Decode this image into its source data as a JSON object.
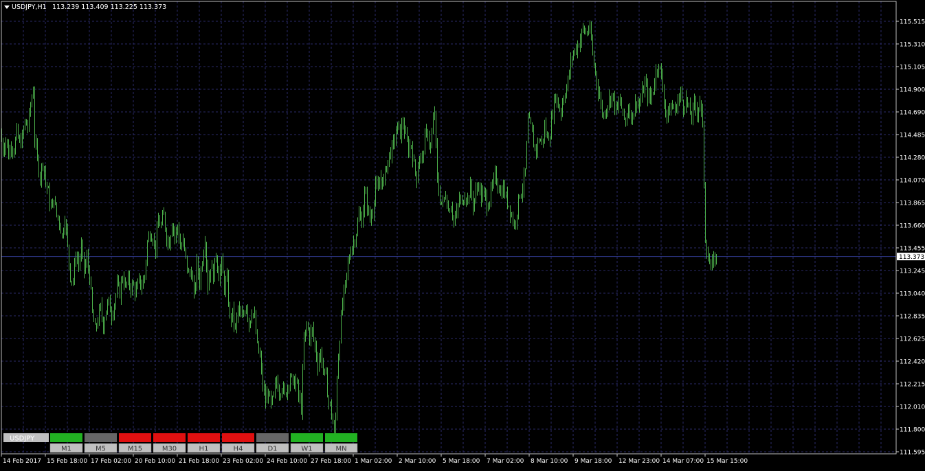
{
  "header": {
    "symbol_timeframe": "USDJPY,H1",
    "ohlc": "113.239 113.409 113.225 113.373"
  },
  "colors": {
    "background": "#000000",
    "grid": "#2a2a68",
    "axis": "#cccccc",
    "text": "#ffffff",
    "bars": "#4db24b",
    "bid_line": "#2f3a8c",
    "signal_green": "#22b222",
    "signal_red": "#e01010",
    "signal_gray": "#666666",
    "tf_label_bg": "#c0c0c0"
  },
  "indicator": {
    "symbol_label": "USDJPY",
    "timeframes": [
      "M1",
      "M5",
      "M15",
      "M30",
      "H1",
      "H4",
      "D1",
      "W1",
      "MN"
    ],
    "states": [
      "green",
      "gray",
      "red",
      "red",
      "red",
      "red",
      "gray",
      "green",
      "green"
    ]
  },
  "chart_data": {
    "type": "ohlc",
    "symbol": "USDJPY",
    "timeframe": "H1",
    "last_price": "113.373",
    "ylim": [
      111.595,
      115.605
    ],
    "y_ticks": [
      "115.515",
      "115.310",
      "115.105",
      "114.900",
      "114.690",
      "114.485",
      "114.280",
      "114.070",
      "113.865",
      "113.660",
      "113.455",
      "113.245",
      "113.040",
      "112.835",
      "112.625",
      "112.420",
      "112.215",
      "112.010",
      "111.800",
      "111.595"
    ],
    "x_ticks": [
      "14 Feb 2017",
      "15 Feb 18:00",
      "17 Feb 02:00",
      "20 Feb 10:00",
      "21 Feb 18:00",
      "23 Feb 02:00",
      "24 Feb 10:00",
      "27 Feb 18:00",
      "1 Mar 02:00",
      "2 Mar 10:00",
      "5 Mar 18:00",
      "7 Mar 02:00",
      "8 Mar 10:00",
      "9 Mar 18:00",
      "12 Mar 23:00",
      "14 Mar 07:00",
      "15 Mar 15:00"
    ],
    "close_path": [
      [
        0,
        114.5
      ],
      [
        4,
        114.35
      ],
      [
        8,
        114.45
      ],
      [
        12,
        114.3
      ],
      [
        16,
        114.4
      ],
      [
        20,
        114.35
      ],
      [
        24,
        114.5
      ],
      [
        28,
        114.4
      ],
      [
        32,
        114.45
      ],
      [
        36,
        114.6
      ],
      [
        40,
        114.55
      ],
      [
        44,
        114.75
      ],
      [
        48,
        114.9
      ],
      [
        50,
        114.45
      ],
      [
        54,
        114.25
      ],
      [
        58,
        114.1
      ],
      [
        62,
        114.25
      ],
      [
        66,
        114.05
      ],
      [
        70,
        113.95
      ],
      [
        74,
        113.8
      ],
      [
        78,
        113.9
      ],
      [
        82,
        113.75
      ],
      [
        86,
        113.7
      ],
      [
        90,
        113.55
      ],
      [
        94,
        113.75
      ],
      [
        98,
        113.45
      ],
      [
        102,
        113.2
      ],
      [
        106,
        113.15
      ],
      [
        110,
        113.4
      ],
      [
        114,
        113.3
      ],
      [
        118,
        113.45
      ],
      [
        122,
        113.25
      ],
      [
        126,
        113.35
      ],
      [
        130,
        113.2
      ],
      [
        134,
        112.85
      ],
      [
        138,
        112.7
      ],
      [
        142,
        112.8
      ],
      [
        146,
        112.9
      ],
      [
        150,
        112.75
      ],
      [
        154,
        112.9
      ],
      [
        158,
        112.95
      ],
      [
        162,
        112.85
      ],
      [
        166,
        112.95
      ],
      [
        170,
        113.1
      ],
      [
        174,
        113.05
      ],
      [
        178,
        113.2
      ],
      [
        182,
        113.1
      ],
      [
        186,
        113.15
      ],
      [
        190,
        113.1
      ],
      [
        194,
        113.1
      ],
      [
        198,
        113.05
      ],
      [
        202,
        113.15
      ],
      [
        206,
        113.1
      ],
      [
        210,
        113.2
      ],
      [
        214,
        113.5
      ],
      [
        218,
        113.6
      ],
      [
        222,
        113.55
      ],
      [
        226,
        113.45
      ],
      [
        230,
        113.7
      ],
      [
        234,
        113.65
      ],
      [
        238,
        113.75
      ],
      [
        242,
        113.55
      ],
      [
        246,
        113.5
      ],
      [
        250,
        113.7
      ],
      [
        254,
        113.55
      ],
      [
        258,
        113.65
      ],
      [
        262,
        113.45
      ],
      [
        266,
        113.5
      ],
      [
        270,
        113.35
      ],
      [
        274,
        113.2
      ],
      [
        278,
        113.25
      ],
      [
        282,
        113.0
      ],
      [
        286,
        113.3
      ],
      [
        290,
        113.15
      ],
      [
        294,
        113.35
      ],
      [
        298,
        113.55
      ],
      [
        302,
        113.1
      ],
      [
        306,
        113.3
      ],
      [
        310,
        113.2
      ],
      [
        314,
        113.4
      ],
      [
        318,
        113.2
      ],
      [
        322,
        113.3
      ],
      [
        326,
        113.1
      ],
      [
        330,
        113.15
      ],
      [
        334,
        112.8
      ],
      [
        338,
        112.85
      ],
      [
        342,
        112.7
      ],
      [
        346,
        112.9
      ],
      [
        350,
        112.8
      ],
      [
        354,
        112.85
      ],
      [
        358,
        112.95
      ],
      [
        362,
        112.75
      ],
      [
        366,
        112.9
      ],
      [
        370,
        112.8
      ],
      [
        374,
        112.55
      ],
      [
        378,
        112.45
      ],
      [
        382,
        112.2
      ],
      [
        386,
        112.05
      ],
      [
        390,
        112.15
      ],
      [
        394,
        112.0
      ],
      [
        398,
        112.1
      ],
      [
        402,
        112.25
      ],
      [
        406,
        112.15
      ],
      [
        410,
        112.2
      ],
      [
        414,
        112.1
      ],
      [
        418,
        112.2
      ],
      [
        422,
        112.3
      ],
      [
        426,
        112.2
      ],
      [
        430,
        112.25
      ],
      [
        434,
        112.1
      ],
      [
        438,
        112.0
      ],
      [
        442,
        112.6
      ],
      [
        446,
        112.75
      ],
      [
        450,
        112.65
      ],
      [
        454,
        112.7
      ],
      [
        458,
        112.55
      ],
      [
        462,
        112.4
      ],
      [
        466,
        112.5
      ],
      [
        470,
        112.35
      ],
      [
        474,
        112.25
      ],
      [
        478,
        112.05
      ],
      [
        482,
        111.95
      ],
      [
        486,
        111.75
      ],
      [
        488,
        111.9
      ],
      [
        490,
        112.3
      ],
      [
        494,
        112.65
      ],
      [
        498,
        112.95
      ],
      [
        502,
        113.1
      ],
      [
        506,
        113.3
      ],
      [
        510,
        113.45
      ],
      [
        514,
        113.5
      ],
      [
        518,
        113.6
      ],
      [
        522,
        113.75
      ],
      [
        526,
        113.7
      ],
      [
        530,
        113.95
      ],
      [
        534,
        113.85
      ],
      [
        538,
        113.7
      ],
      [
        542,
        113.8
      ],
      [
        546,
        114.05
      ],
      [
        550,
        113.95
      ],
      [
        554,
        114.1
      ],
      [
        558,
        114.05
      ],
      [
        562,
        114.2
      ],
      [
        566,
        114.3
      ],
      [
        570,
        114.35
      ],
      [
        574,
        114.45
      ],
      [
        578,
        114.55
      ],
      [
        582,
        114.5
      ],
      [
        586,
        114.6
      ],
      [
        590,
        114.45
      ],
      [
        594,
        114.35
      ],
      [
        598,
        114.4
      ],
      [
        602,
        114.2
      ],
      [
        606,
        114.1
      ],
      [
        610,
        114.3
      ],
      [
        614,
        114.25
      ],
      [
        618,
        114.45
      ],
      [
        622,
        114.5
      ],
      [
        626,
        114.35
      ],
      [
        630,
        114.6
      ],
      [
        632,
        114.7
      ],
      [
        636,
        114.05
      ],
      [
        640,
        113.9
      ],
      [
        644,
        113.85
      ],
      [
        648,
        113.95
      ],
      [
        652,
        113.8
      ],
      [
        656,
        113.85
      ],
      [
        660,
        113.7
      ],
      [
        664,
        113.75
      ],
      [
        668,
        113.9
      ],
      [
        672,
        113.85
      ],
      [
        676,
        113.95
      ],
      [
        680,
        113.9
      ],
      [
        684,
        114.0
      ],
      [
        688,
        113.85
      ],
      [
        692,
        113.95
      ],
      [
        696,
        114.05
      ],
      [
        700,
        113.9
      ],
      [
        704,
        113.95
      ],
      [
        708,
        113.85
      ],
      [
        712,
        113.9
      ],
      [
        716,
        114.0
      ],
      [
        720,
        114.1
      ],
      [
        724,
        114.05
      ],
      [
        728,
        113.95
      ],
      [
        732,
        114.0
      ],
      [
        736,
        113.9
      ],
      [
        740,
        113.85
      ],
      [
        744,
        113.75
      ],
      [
        748,
        113.65
      ],
      [
        752,
        113.8
      ],
      [
        756,
        113.95
      ],
      [
        760,
        114.0
      ],
      [
        764,
        114.15
      ],
      [
        768,
        114.6
      ],
      [
        772,
        114.55
      ],
      [
        776,
        114.4
      ],
      [
        780,
        114.35
      ],
      [
        784,
        114.45
      ],
      [
        788,
        114.4
      ],
      [
        792,
        114.55
      ],
      [
        796,
        114.45
      ],
      [
        800,
        114.5
      ],
      [
        804,
        114.7
      ],
      [
        808,
        114.85
      ],
      [
        812,
        114.75
      ],
      [
        816,
        114.7
      ],
      [
        820,
        114.85
      ],
      [
        824,
        114.9
      ],
      [
        828,
        115.05
      ],
      [
        832,
        115.2
      ],
      [
        836,
        115.25
      ],
      [
        840,
        115.3
      ],
      [
        844,
        115.35
      ],
      [
        848,
        115.45
      ],
      [
        852,
        115.4
      ],
      [
        856,
        115.45
      ],
      [
        860,
        115.35
      ],
      [
        862,
        115.2
      ],
      [
        866,
        115.05
      ],
      [
        870,
        114.9
      ],
      [
        874,
        114.75
      ],
      [
        878,
        114.65
      ],
      [
        882,
        114.75
      ],
      [
        886,
        114.8
      ],
      [
        890,
        114.85
      ],
      [
        894,
        114.75
      ],
      [
        898,
        114.7
      ],
      [
        902,
        114.8
      ],
      [
        906,
        114.65
      ],
      [
        910,
        114.6
      ],
      [
        914,
        114.75
      ],
      [
        918,
        114.65
      ],
      [
        922,
        114.7
      ],
      [
        926,
        114.8
      ],
      [
        930,
        114.75
      ],
      [
        934,
        114.85
      ],
      [
        938,
        114.95
      ],
      [
        942,
        114.85
      ],
      [
        946,
        114.8
      ],
      [
        950,
        114.9
      ],
      [
        954,
        115.05
      ],
      [
        958,
        115.15
      ],
      [
        962,
        115.0
      ],
      [
        966,
        114.8
      ],
      [
        970,
        114.65
      ],
      [
        974,
        114.7
      ],
      [
        978,
        114.75
      ],
      [
        982,
        114.7
      ],
      [
        986,
        114.8
      ],
      [
        990,
        114.85
      ],
      [
        994,
        114.75
      ],
      [
        998,
        114.8
      ],
      [
        1002,
        114.7
      ],
      [
        1006,
        114.65
      ],
      [
        1010,
        114.75
      ],
      [
        1014,
        114.7
      ],
      [
        1018,
        114.8
      ],
      [
        1022,
        114.55
      ],
      [
        1026,
        113.55
      ],
      [
        1030,
        113.35
      ],
      [
        1034,
        113.25
      ],
      [
        1038,
        113.35
      ],
      [
        1042,
        113.37
      ]
    ]
  }
}
